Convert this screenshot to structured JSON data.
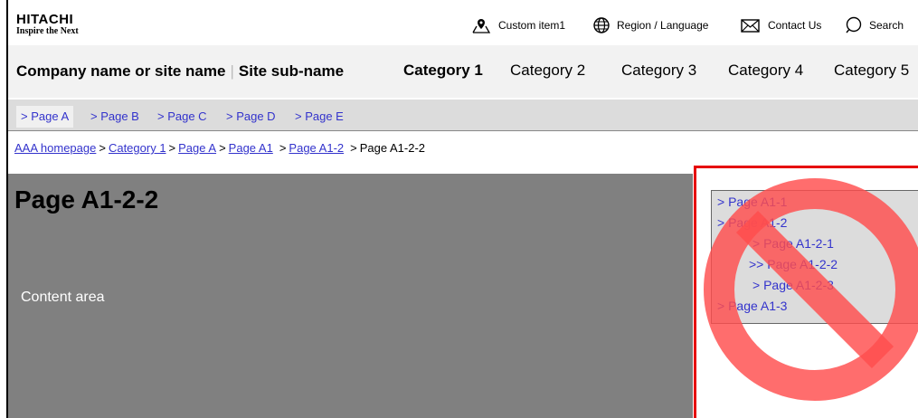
{
  "logo": {
    "line1": "HITACHI",
    "line2": "Inspire the Next"
  },
  "utility": [
    {
      "label": "Custom item1",
      "icon": "map-pin-icon"
    },
    {
      "label": "Region / Language",
      "icon": "globe-icon"
    },
    {
      "label": "Contact Us",
      "icon": "envelope-icon"
    },
    {
      "label": "Search",
      "icon": "search-icon"
    }
  ],
  "header": {
    "site_name": "Company name or site name",
    "separator": "|",
    "site_sub": "Site sub-name",
    "categories": [
      "Category 1",
      "Category 2",
      "Category 3",
      "Category 4",
      "Category 5"
    ]
  },
  "subnav": [
    "> Page A",
    "> Page B",
    "> Page C",
    "> Page D",
    "> Page E"
  ],
  "breadcrumb": {
    "links": [
      "AAA homepage",
      "Category 1",
      "Page A",
      "Page A1",
      "Page A1-2"
    ],
    "separator": ">",
    "current": "Page A1-2-2"
  },
  "content": {
    "title": "Page A1-2-2",
    "label": "Content area"
  },
  "localnav": [
    "> Page A1-1",
    "> Page A1-2",
    "> Page A1-2-1",
    ">> Page A1-2-2",
    "> Page A1-2-3",
    "> Page A1-3"
  ],
  "colors": {
    "link": "#3333cc",
    "content_bg": "#808080",
    "warning": "#e60000",
    "prohibit": "#ff4d4d"
  }
}
